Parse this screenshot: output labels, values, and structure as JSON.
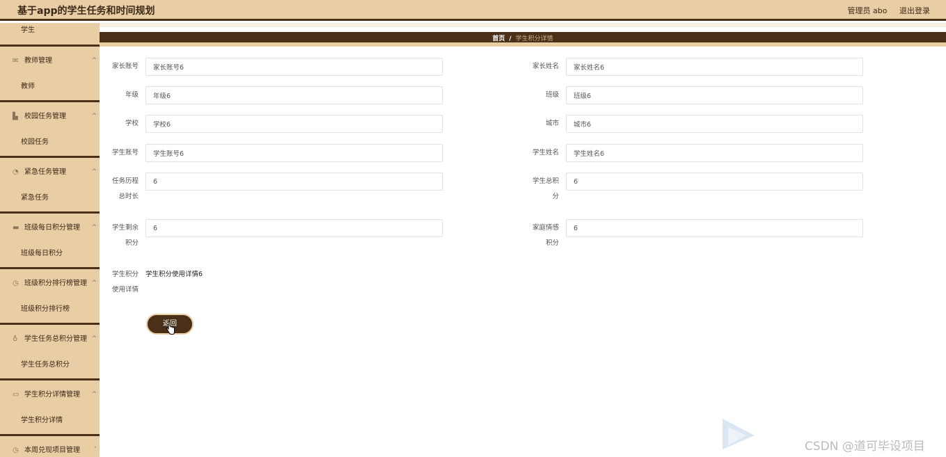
{
  "app": {
    "title": "基于app的学生任务和时间规划",
    "user_label": "管理员 abo",
    "logout_label": "退出登录"
  },
  "sidebar": {
    "top_sub": "学生",
    "groups": [
      {
        "label": "教师管理",
        "icon": "mail-icon",
        "sub": "教师"
      },
      {
        "label": "校园任务管理",
        "icon": "chart-icon",
        "sub": "校园任务"
      },
      {
        "label": "紧急任务管理",
        "icon": "gauge-icon",
        "sub": "紧急任务"
      },
      {
        "label": "班级每日积分管理",
        "icon": "briefcase-icon",
        "sub": "班级每日积分"
      },
      {
        "label": "班级积分排行榜管理",
        "icon": "compass-icon",
        "sub": "班级积分排行榜"
      },
      {
        "label": "学生任务总积分管理",
        "icon": "mic-icon",
        "sub": "学生任务总积分"
      },
      {
        "label": "学生积分详情管理",
        "icon": "card-icon",
        "sub": "学生积分详情"
      },
      {
        "label": "本周兑现项目管理",
        "icon": "clock-icon",
        "sub": ""
      }
    ]
  },
  "breadcrumb": {
    "home": "首页",
    "separator": "/",
    "current": "学生积分详情"
  },
  "form": {
    "parent_account": {
      "label": "家长账号",
      "value": "家长账号6"
    },
    "parent_name": {
      "label": "家长姓名",
      "value": "家长姓名6"
    },
    "grade": {
      "label": "年级",
      "value": "年级6"
    },
    "class": {
      "label": "班级",
      "value": "班级6"
    },
    "school": {
      "label": "学校",
      "value": "学校6"
    },
    "city": {
      "label": "城市",
      "value": "城市6"
    },
    "student_account": {
      "label": "学生账号",
      "value": "学生账号6"
    },
    "student_name": {
      "label": "学生姓名",
      "value": "学生姓名6"
    },
    "task_duration": {
      "label": "任务历程",
      "label2": "总时长",
      "value": "6"
    },
    "total_points": {
      "label": "学生总积",
      "label2": "分",
      "value": "6"
    },
    "remaining_points": {
      "label": "学生剩余",
      "label2": "积分",
      "value": "6"
    },
    "family_points": {
      "label": "家庭情感",
      "label2": "积分",
      "value": "6"
    },
    "usage_detail": {
      "label": "学生积分",
      "label2": "使用详情",
      "value": "学生积分使用详情6"
    },
    "back_label": "返回"
  },
  "watermark": "CSDN @道可毕设项目"
}
